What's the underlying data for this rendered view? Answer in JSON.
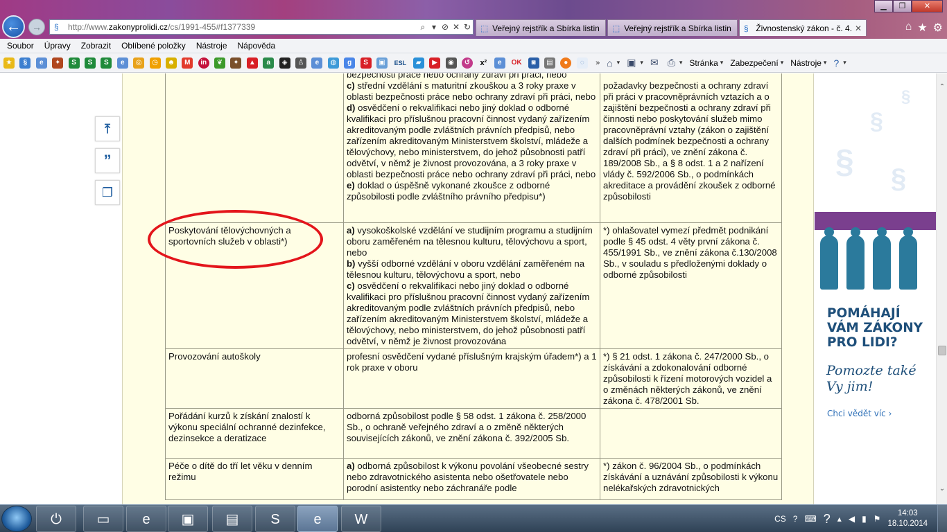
{
  "browser": {
    "url_prefix": "http://www.",
    "url_domain": "zakonyprolidi.cz",
    "url_path": "/cs/1991-455#f1377339",
    "tabs": [
      {
        "label": "Veřejný rejstřík a Sbírka listin ..."
      },
      {
        "label": "Veřejný rejstřík a Sbírka listin ..."
      },
      {
        "label": "Živnostenský zákon - č. 4..."
      }
    ],
    "menu": [
      "Soubor",
      "Úpravy",
      "Zobrazit",
      "Oblíbené položky",
      "Nástroje",
      "Nápověda"
    ],
    "fav_labels": [
      "ESL",
      "x²",
      "OK"
    ],
    "commands": {
      "page": "Stránka",
      "safety": "Zabezpečení",
      "tools": "Nástroje"
    }
  },
  "table": {
    "row0": {
      "col2_lines": [
        {
          "b": "",
          "t": "bezpečnosti práce nebo ochrany zdraví při práci, nebo"
        },
        {
          "b": "c)",
          "t": " střední vzdělání s maturitní zkouškou a 3 roky praxe v oblasti bezpečnosti práce nebo ochrany zdraví při práci, nebo"
        },
        {
          "b": "d)",
          "t": " osvědčení o rekvalifikaci nebo jiný doklad o odborné kvalifikaci pro příslušnou pracovní činnost vydaný zařízením akreditovaným podle zvláštních právních předpisů, nebo zařízením akreditovaným Ministerstvem školství, mládeže a tělovýchovy, nebo ministerstvem, do jehož působnosti patří odvětví, v němž je živnost provozována, a 3 roky praxe v oblasti bezpečnosti práce nebo ochrany zdraví při práci, nebo"
        },
        {
          "b": "e)",
          "t": " doklad o úspěšně vykonané zkoušce z odborné způsobilosti podle zvláštního právního předpisu*)"
        }
      ],
      "col3": "požadavky bezpečnosti a ochrany zdraví při práci v pracovněprávních vztazích a o zajištění bezpečnosti a ochrany zdraví při činnosti nebo poskytování služeb mimo pracovněprávní vztahy (zákon o zajištění dalších podmínek bezpečnosti a ochrany zdraví při práci), ve znění zákona č. 189/2008 Sb., a § 8 odst. 1 a 2 nařízení vlády č. 592/2006 Sb., o podmínkách akreditace a provádění zkoušek z odborné způsobilosti"
    },
    "row1": {
      "col1": "Poskytování tělovýchovných a sportovních služeb v oblasti*)",
      "col2_lines": [
        {
          "b": "a)",
          "t": " vysokoškolské vzdělání ve studijním programu a studijním oboru zaměřeném na tělesnou kulturu, tělovýchovu a sport, nebo"
        },
        {
          "b": "b)",
          "t": " vyšší odborné vzdělání v oboru vzdělání zaměřeném na tělesnou kulturu, tělovýchovu a sport, nebo"
        },
        {
          "b": "c)",
          "t": " osvědčení o rekvalifikaci nebo jiný doklad o odborné kvalifikaci pro příslušnou pracovní činnost vydaný zařízením akreditovaným podle zvláštních právních předpisů, nebo zařízením akreditovaným Ministerstvem školství, mládeže a tělovýchovy, nebo ministerstvem, do jehož působnosti patří odvětví, v němž je živnost provozována"
        }
      ],
      "col3": "*) ohlašovatel vymezí předmět podnikání podle § 45 odst. 4 věty první zákona č. 455/1991 Sb., ve znění zákona č.130/2008 Sb., v souladu s předloženými doklady o odborné způsobilosti"
    },
    "row2": {
      "col1": "Provozování autoškoly",
      "col2": "profesní osvědčení vydané příslušným krajským úřadem*) a 1 rok praxe v oboru",
      "col3": "*) § 21 odst. 1 zákona č. 247/2000 Sb., o získávání a zdokonalování odborné způsobilosti k řízení motorových vozidel a o změnách některých zákonů, ve znění zákona č. 478/2001 Sb."
    },
    "row3": {
      "col1": "Pořádání kurzů k získání znalostí k výkonu speciální ochranné dezinfekce, dezinsekce a deratizace",
      "col2": "odborná způsobilost podle § 58 odst. 1 zákona č. 258/2000 Sb., o ochraně veřejného zdraví a o změně některých souvisejících zákonů, ve znění zákona č. 392/2005 Sb.",
      "col3": ""
    },
    "row4": {
      "col1": "Péče o dítě do tří let věku v denním režimu",
      "col2_lines": [
        {
          "b": "a)",
          "t": " odborná způsobilost k výkonu povolání všeobecné sestry nebo zdravotnického asistenta nebo ošetřovatele nebo porodní asistentky nebo záchranáře podle"
        }
      ],
      "col3": "*) zákon č. 96/2004 Sb., o podmínkách získávání a uznávání způsobilosti k výkonu nelékařských zdravotnických"
    }
  },
  "ad": {
    "title": "POMÁHAJÍ VÁM ZÁKONY PRO LIDI?",
    "subtitle": "Pomozte také Vy jim!",
    "link": "Chci vědět víc ›"
  },
  "taskbar": {
    "lang": "CS",
    "time": "14:03",
    "date": "18.10.2014"
  }
}
